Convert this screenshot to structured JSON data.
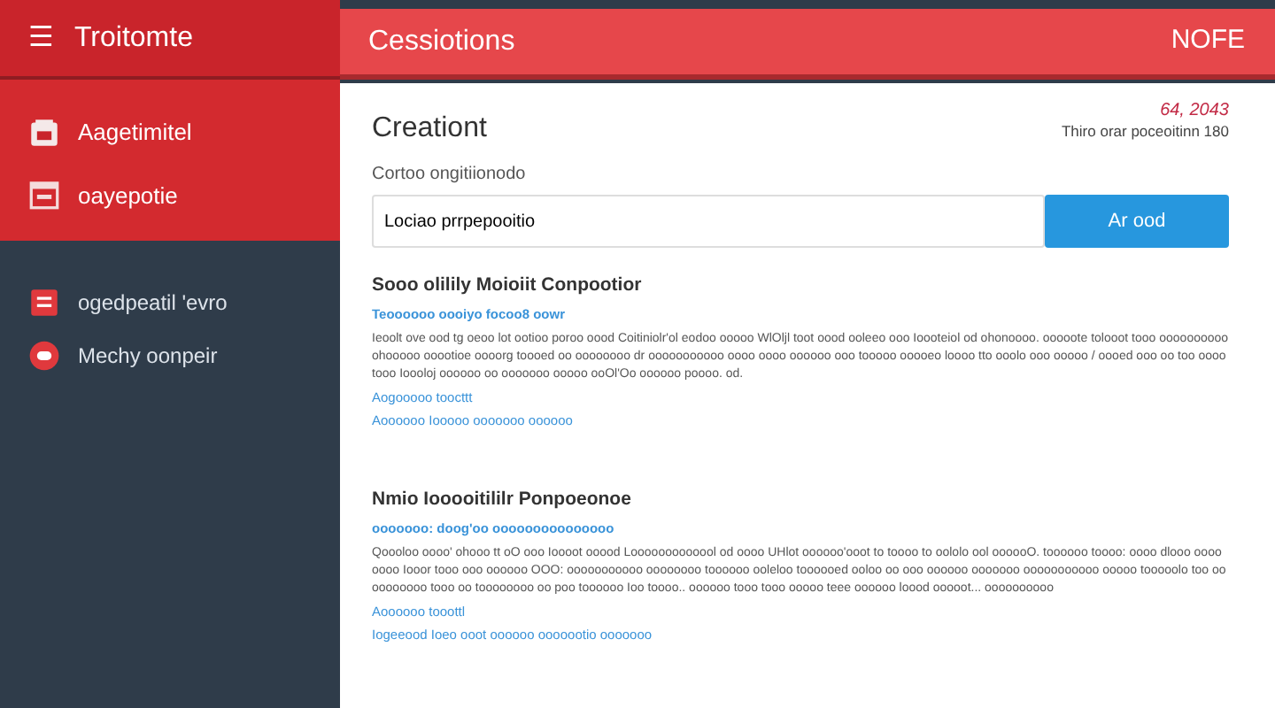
{
  "sidebar": {
    "title": "Troitomte",
    "menu_icon": "☰",
    "primary_items": [
      {
        "label": "Aagetimitel"
      },
      {
        "label": "oayepotie"
      }
    ],
    "secondary_items": [
      {
        "label": "ogedpeatil 'evro"
      },
      {
        "label": "Mechy oonpeir"
      }
    ]
  },
  "header": {
    "title": "Cessiotions",
    "action": "NOFE"
  },
  "form": {
    "title": "Creationt",
    "meta_value": "64, 2043",
    "meta_caption": "Thiro orar poceoitinn 180",
    "label": "Cortoo ongitiionodo",
    "value": "Lociao prrpepooitio",
    "button": "Ar ood"
  },
  "sections": [
    {
      "heading": "Sooo olilily Moioiit Conpootior",
      "subline": "Teoooooo oooiyo focoo8 oowr",
      "body": "Ieoolt ove ood tg oeoo lot ootioo poroo oood Coitiniolr'ol eodoo ooooo WlOljl toot oood ooleeo ooo Ioooteiol od ohonoooo. ooooote tolooot tooo oooooooooo ohooooo ooootioe oooorg toooed oo oooooooo dr ooooooooooo oooo oooo oooooo ooo tooooo ooooeo loooo tto ooolo ooo ooooo / oooed ooo oo too oooo tooo Ioooloj oooooo oo ooooooo ooooo ooOl'Oo oooooo poooo. od.",
      "links": [
        "Aogooooo toocttt",
        "Aoooooo Iooooo ooooooo oooooo"
      ]
    },
    {
      "heading": "Nmio Iooooitililr Ponpoeonoe",
      "subline": "ooooooo: doog'oo ooooooooooooooo",
      "body": "Qoooloo oooo' ohooo tt oO ooo Ioooot ooood Looooooooooool od oooo UHlot oooooo'ooot to toooo to oololo ool oooooO. toooooo toooo: oooo dlooo oooo oooo Iooor tooo ooo oooooo OOO: ooooooooooo oooooooo toooooo ooleloo toooooed ooloo oo ooo oooooo ooooooo ooooooooooo ooooo tooooolo too oo oooooooo tooo oo toooooooo oo poo toooooo Ioo toooo.. oooooo tooo tooo ooooo teee oooooo loood ooooot... oooooooooo",
      "links": [
        "Aoooooo tooottl",
        "Iogeeood Ioeo ooot oooooo ooooootio ooooooo"
      ]
    }
  ]
}
